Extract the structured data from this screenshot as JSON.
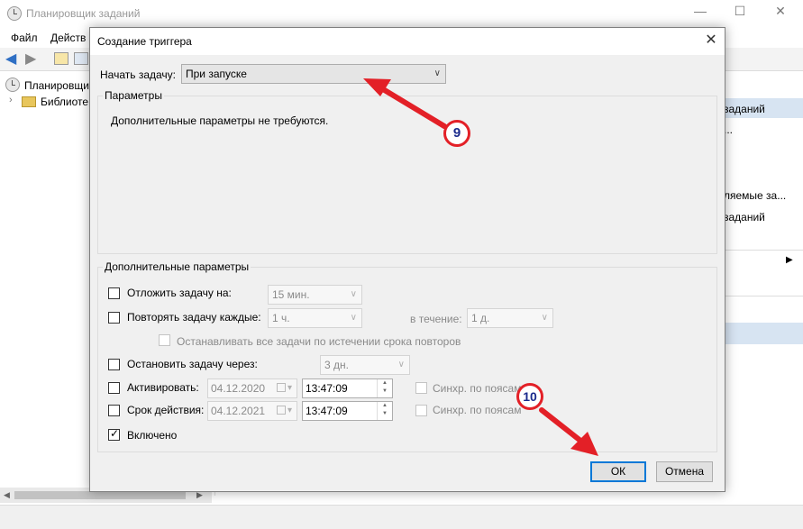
{
  "app": {
    "title": "Планировщик заданий",
    "menu": [
      "Файл",
      "Действ"
    ],
    "tree": {
      "root": "Планировщик",
      "child": "Библиоте"
    },
    "actions": [
      "заданий",
      "...",
      "ляемые за...",
      "заданий"
    ]
  },
  "dialog": {
    "title": "Создание триггера",
    "start_task_label": "Начать задачу:",
    "start_task_value": "При запуске",
    "params_legend": "Параметры",
    "params_text": "Дополнительные параметры не требуются.",
    "advanced_legend": "Дополнительные параметры",
    "delay": {
      "label": "Отложить задачу на:",
      "value": "15 мин.",
      "checked": false
    },
    "repeat": {
      "label": "Повторять задачу каждые:",
      "value": "1 ч.",
      "duration_label": "в течение:",
      "duration_value": "1 д.",
      "checked": false
    },
    "stop_all": {
      "label": "Останавливать все задачи по истечении срока повторов",
      "checked": false
    },
    "stop_after": {
      "label": "Остановить задачу через:",
      "value": "3 дн.",
      "checked": false
    },
    "activate": {
      "label": "Активировать:",
      "date": "04.12.2020",
      "time": "13:47:09",
      "sync_label": "Синхр. по поясам",
      "checked": false
    },
    "expire": {
      "label": "Срок действия:",
      "date": "04.12.2021",
      "time": "13:47:09",
      "sync_label": "Синхр. по поясам",
      "checked": false
    },
    "enabled": {
      "label": "Включено",
      "checked": true
    },
    "ok_label": "ОК",
    "cancel_label": "Отмена"
  },
  "annotations": {
    "step9": "9",
    "step10": "10"
  },
  "colors": {
    "arrow": "#e32027",
    "callout_text": "#1a2a8c",
    "default_button_border": "#0078d7"
  }
}
